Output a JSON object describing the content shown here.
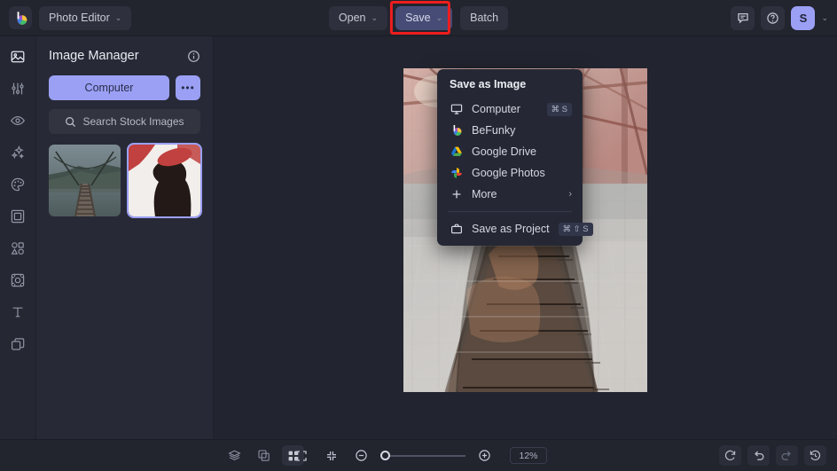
{
  "topbar": {
    "logo_icon": "befunky-logo-icon",
    "workspace": {
      "label": "Photo Editor",
      "chevron": "⌄"
    },
    "open": {
      "label": "Open",
      "chevron": "⌄"
    },
    "save": {
      "label": "Save",
      "chevron": "⌄",
      "highlight_color": "#ee1d1d",
      "bg_color": "#474c77"
    },
    "batch": {
      "label": "Batch"
    },
    "feedback_icon": "speech-bubble-icon",
    "help_icon": "question-mark-icon",
    "avatar": {
      "initial": "S",
      "bg_color": "#9ba0f5"
    },
    "avatar_chevron": "⌄"
  },
  "rail": {
    "items": [
      {
        "name": "image-manager",
        "icon": "image-icon",
        "active": true
      },
      {
        "name": "edit",
        "icon": "sliders-icon",
        "active": false
      },
      {
        "name": "touch-up",
        "icon": "eye-icon",
        "active": false
      },
      {
        "name": "effects",
        "icon": "sparkles-icon",
        "active": false
      },
      {
        "name": "artsy",
        "icon": "palette-icon",
        "active": false
      },
      {
        "name": "frames",
        "icon": "frame-icon",
        "active": false
      },
      {
        "name": "graphics",
        "icon": "shapes-icon",
        "active": false
      },
      {
        "name": "textures",
        "icon": "texture-icon",
        "active": false
      },
      {
        "name": "text",
        "icon": "text-t-icon",
        "active": false
      },
      {
        "name": "layers",
        "icon": "layers-icon",
        "active": false
      }
    ]
  },
  "panel": {
    "title": "Image Manager",
    "info_icon": "info-circle-icon",
    "computer_button": "Computer",
    "more_button": "•••",
    "search": {
      "label": "Search Stock Images",
      "icon": "search-icon"
    },
    "thumbnails": [
      {
        "name": "suspension-bridge-photo",
        "selected": false
      },
      {
        "name": "silhouette-portrait-photo",
        "selected": true
      }
    ]
  },
  "dropdown": {
    "title": "Save as Image",
    "items": [
      {
        "label": "Computer",
        "icon": "monitor-icon",
        "shortcut": "⌘ S"
      },
      {
        "label": "BeFunky",
        "icon": "befunky-logo-icon",
        "shortcut": ""
      },
      {
        "label": "Google Drive",
        "icon": "google-drive-icon",
        "shortcut": ""
      },
      {
        "label": "Google Photos",
        "icon": "google-photos-icon",
        "shortcut": ""
      },
      {
        "label": "More",
        "icon": "plus-icon",
        "shortcut": "",
        "submenu_arrow": "›"
      }
    ],
    "project": {
      "label": "Save as Project",
      "icon": "briefcase-icon",
      "shortcut": "⌘ ⇧ S"
    }
  },
  "canvas": {
    "image_name": "double-exposure-bridge-silhouette"
  },
  "bottombar": {
    "left_tools": [
      {
        "name": "layers-tool",
        "icon": "layers-stack-icon",
        "active": false
      },
      {
        "name": "overlap-tool",
        "icon": "overlap-shapes-icon",
        "active": false
      },
      {
        "name": "grid-tool",
        "icon": "grid-four-icon",
        "active": true
      }
    ],
    "fullscreen_icon": "expand-corners-icon",
    "fit_screen_icon": "collapse-corners-icon",
    "zoom_out_icon": "minus-circle-icon",
    "zoom_in_icon": "plus-circle-icon",
    "zoom_value": "12%",
    "right_tools": [
      {
        "name": "reset-button",
        "icon": "refresh-icon",
        "dim": false
      },
      {
        "name": "undo-button",
        "icon": "undo-arrow-icon",
        "dim": false
      },
      {
        "name": "redo-button",
        "icon": "redo-arrow-icon",
        "dim": true
      },
      {
        "name": "history-button",
        "icon": "history-clock-icon",
        "dim": false
      }
    ]
  }
}
